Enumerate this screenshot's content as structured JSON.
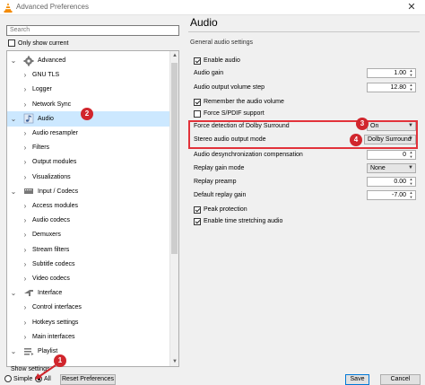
{
  "window": {
    "title": "Advanced Preferences"
  },
  "search": {
    "placeholder": "Search"
  },
  "only_show_current": {
    "label": "Only show current",
    "checked": false
  },
  "tree": [
    {
      "label": "Advanced",
      "level": 0,
      "icon": "gear-icon"
    },
    {
      "label": "GNU TLS",
      "level": 1
    },
    {
      "label": "Logger",
      "level": 1
    },
    {
      "label": "Network Sync",
      "level": 1
    },
    {
      "label": "Audio",
      "level": 0,
      "icon": "audio-note-icon",
      "selected": true
    },
    {
      "label": "Audio resampler",
      "level": 1
    },
    {
      "label": "Filters",
      "level": 1
    },
    {
      "label": "Output modules",
      "level": 1
    },
    {
      "label": "Visualizations",
      "level": 1
    },
    {
      "label": "Input / Codecs",
      "level": 0,
      "icon": "input-codecs-icon"
    },
    {
      "label": "Access modules",
      "level": 1
    },
    {
      "label": "Audio codecs",
      "level": 1
    },
    {
      "label": "Demuxers",
      "level": 1
    },
    {
      "label": "Stream filters",
      "level": 1
    },
    {
      "label": "Subtitle codecs",
      "level": 1
    },
    {
      "label": "Video codecs",
      "level": 1
    },
    {
      "label": "Interface",
      "level": 0,
      "icon": "interface-icon"
    },
    {
      "label": "Control interfaces",
      "level": 1
    },
    {
      "label": "Hotkeys settings",
      "level": 1
    },
    {
      "label": "Main interfaces",
      "level": 1
    },
    {
      "label": "Playlist",
      "level": 0,
      "icon": "playlist-icon"
    }
  ],
  "show_settings": {
    "label": "Show settings",
    "simple": "Simple",
    "all": "All",
    "selected": "All"
  },
  "buttons": {
    "reset": "Reset Preferences",
    "save": "Save",
    "cancel": "Cancel"
  },
  "panel": {
    "title": "Audio",
    "group_title": "General audio settings",
    "enable_audio": {
      "label": "Enable audio",
      "checked": true
    },
    "audio_gain": {
      "label": "Audio gain",
      "value": "1.00"
    },
    "volume_step": {
      "label": "Audio output volume step",
      "value": "12.80"
    },
    "remember_volume": {
      "label": "Remember the audio volume",
      "checked": true
    },
    "force_spdif": {
      "label": "Force S/PDIF support",
      "checked": false
    },
    "force_dolby": {
      "label": "Force detection of Dolby Surround",
      "value": "On"
    },
    "stereo_mode": {
      "label": "Stereo audio output mode",
      "value": "Dolby Surround"
    },
    "desync": {
      "label": "Audio desynchronization compensation",
      "value": "0"
    },
    "replay_gain_mode": {
      "label": "Replay gain mode",
      "value": "None"
    },
    "replay_preamp": {
      "label": "Replay preamp",
      "value": "0.00"
    },
    "default_replay_gain": {
      "label": "Default replay gain",
      "value": "-7.00"
    },
    "peak_protection": {
      "label": "Peak protection",
      "checked": true
    },
    "time_stretching": {
      "label": "Enable time stretching audio",
      "checked": true
    }
  },
  "annotations": [
    "1",
    "2",
    "3",
    "4"
  ],
  "colors": {
    "highlight": "#e2323a",
    "badge": "#d1262d",
    "selected_row": "#cce8ff"
  }
}
